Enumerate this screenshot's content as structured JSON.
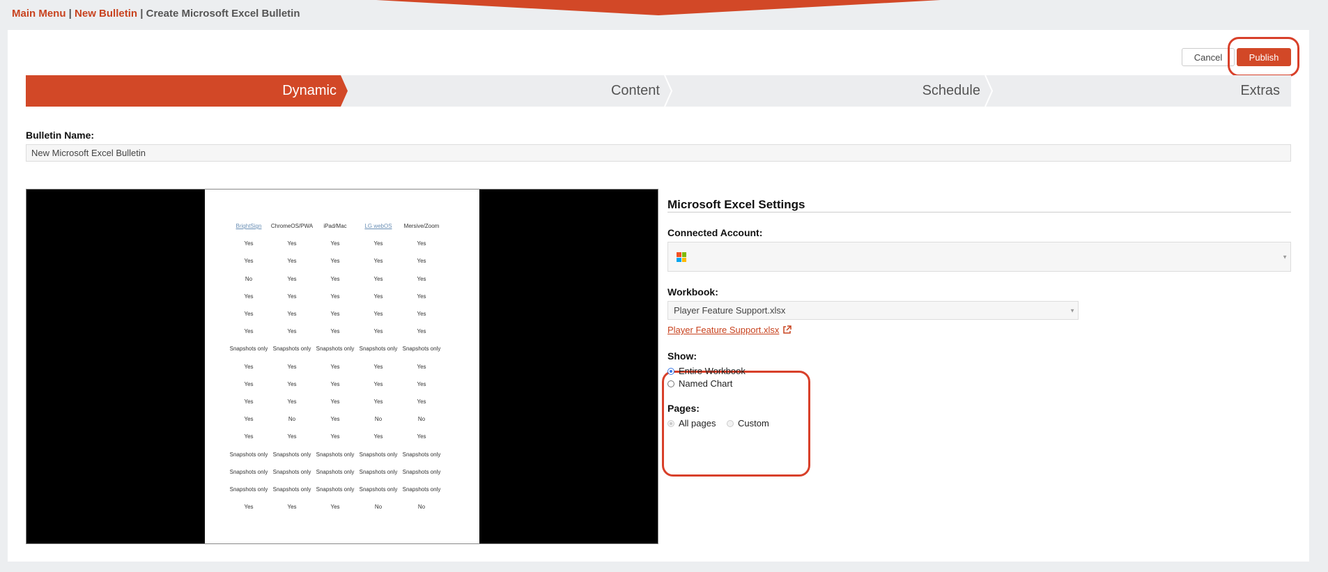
{
  "breadcrumb": {
    "main_menu": "Main Menu",
    "separator": "|",
    "new_bulletin": "New Bulletin",
    "current": "Create Microsoft Excel Bulletin"
  },
  "toolbar": {
    "cancel_label": "Cancel",
    "publish_label": "Publish"
  },
  "steps": [
    "Dynamic",
    "Content",
    "Schedule",
    "Extras"
  ],
  "active_step": "Dynamic",
  "bulletin_name": {
    "label": "Bulletin Name:",
    "value": "New Microsoft Excel Bulletin"
  },
  "preview": {
    "headers": [
      "BrightSign",
      "ChromeOS/PWA",
      "iPad/Mac",
      "LG webOS",
      "Mersive/Zoom"
    ],
    "rows": [
      [
        "Yes",
        "Yes",
        "Yes",
        "Yes",
        "Yes"
      ],
      [
        "Yes",
        "Yes",
        "Yes",
        "Yes",
        "Yes"
      ],
      [
        "No",
        "Yes",
        "Yes",
        "Yes",
        "Yes"
      ],
      [
        "Yes",
        "Yes",
        "Yes",
        "Yes",
        "Yes"
      ],
      [
        "Yes",
        "Yes",
        "Yes",
        "Yes",
        "Yes"
      ],
      [
        "Yes",
        "Yes",
        "Yes",
        "Yes",
        "Yes"
      ],
      [
        "Snapshots only",
        "Snapshots only",
        "Snapshots only",
        "Snapshots only",
        "Snapshots only"
      ],
      [
        "Yes",
        "Yes",
        "Yes",
        "Yes",
        "Yes"
      ],
      [
        "Yes",
        "Yes",
        "Yes",
        "Yes",
        "Yes"
      ],
      [
        "Yes",
        "Yes",
        "Yes",
        "Yes",
        "Yes"
      ],
      [
        "Yes",
        "No",
        "Yes",
        "No",
        "No"
      ],
      [
        "Yes",
        "Yes",
        "Yes",
        "Yes",
        "Yes"
      ],
      [
        "Snapshots only",
        "Snapshots only",
        "Snapshots only",
        "Snapshots only",
        "Snapshots only"
      ],
      [
        "Snapshots only",
        "Snapshots only",
        "Snapshots only",
        "Snapshots only",
        "Snapshots only"
      ],
      [
        "Snapshots only",
        "Snapshots only",
        "Snapshots only",
        "Snapshots only",
        "Snapshots only"
      ],
      [
        "Yes",
        "Yes",
        "Yes",
        "No",
        "No"
      ]
    ]
  },
  "settings": {
    "title": "Microsoft Excel Settings",
    "connected_account_label": "Connected Account:",
    "workbook_label": "Workbook:",
    "workbook_value": "Player Feature Support.xlsx",
    "workbook_link": "Player Feature Support.xlsx",
    "show_label": "Show:",
    "show_options": [
      "Entire Workbook",
      "Named Chart"
    ],
    "show_selected": "Entire Workbook",
    "pages_label": "Pages:",
    "pages_options": [
      "All pages",
      "Custom"
    ],
    "pages_selected": "All pages"
  },
  "colors": {
    "accent": "#d24827",
    "highlight": "#d8402a",
    "ms_logo": [
      "#f25022",
      "#7fba00",
      "#00a4ef",
      "#ffb900"
    ]
  }
}
